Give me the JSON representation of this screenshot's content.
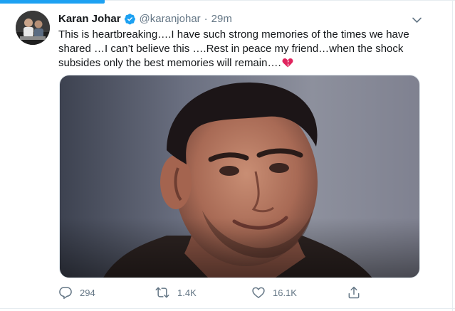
{
  "tweet": {
    "author_name": "Karan Johar",
    "verified": true,
    "handle": "@karanjohar",
    "separator": "·",
    "time": "29m",
    "text_lines": [
      "This is heartbreaking….I have such strong memories of the times we have",
      "shared …I can’t believe this ….Rest in peace my friend…when the shock",
      "subsides only the best memories will remain…."
    ],
    "emoji": "broken-heart-icon"
  },
  "actions": {
    "reply_count": "294",
    "retweet_count": "1.4K",
    "like_count": "16.1K"
  },
  "colors": {
    "accent": "#1da1f2",
    "text_primary": "#14171a",
    "text_secondary": "#657786",
    "broken_heart": "#e0245e"
  }
}
